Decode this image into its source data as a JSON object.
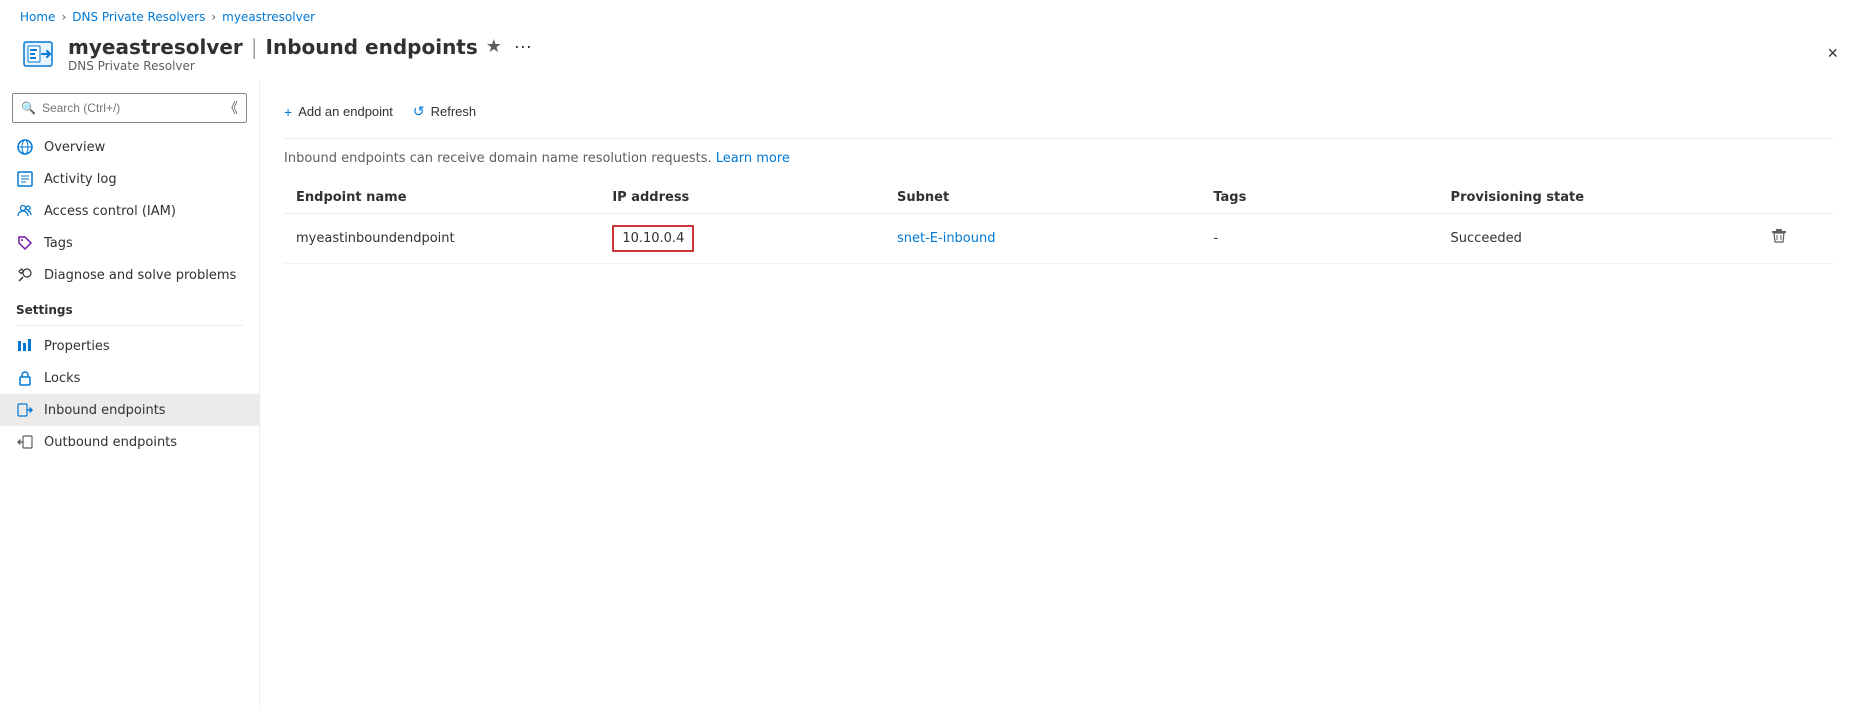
{
  "breadcrumb": {
    "home": "Home",
    "dns_private_resolvers": "DNS Private Resolvers",
    "resolver": "myeastresolver",
    "separator": ">"
  },
  "header": {
    "resource_name": "myeastresolver",
    "separator": "|",
    "page_title": "Inbound endpoints",
    "subtitle": "DNS Private Resolver",
    "star_symbol": "★",
    "ellipsis_symbol": "···",
    "close_symbol": "×"
  },
  "sidebar": {
    "search_placeholder": "Search (Ctrl+/)",
    "collapse_symbol": "《",
    "nav_items": [
      {
        "id": "overview",
        "label": "Overview",
        "icon": "globe"
      },
      {
        "id": "activity-log",
        "label": "Activity log",
        "icon": "activity"
      },
      {
        "id": "access-control",
        "label": "Access control (IAM)",
        "icon": "people"
      },
      {
        "id": "tags",
        "label": "Tags",
        "icon": "tag"
      },
      {
        "id": "diagnose",
        "label": "Diagnose and solve problems",
        "icon": "wrench"
      }
    ],
    "settings_label": "Settings",
    "settings_items": [
      {
        "id": "properties",
        "label": "Properties",
        "icon": "properties"
      },
      {
        "id": "locks",
        "label": "Locks",
        "icon": "lock"
      },
      {
        "id": "inbound-endpoints",
        "label": "Inbound endpoints",
        "icon": "inbound",
        "active": true
      },
      {
        "id": "outbound-endpoints",
        "label": "Outbound endpoints",
        "icon": "outbound"
      }
    ]
  },
  "toolbar": {
    "add_label": "Add an endpoint",
    "add_icon": "+",
    "refresh_label": "Refresh",
    "refresh_icon": "↺"
  },
  "info_bar": {
    "text": "Inbound endpoints can receive domain name resolution requests.",
    "learn_more": "Learn more"
  },
  "table": {
    "columns": {
      "endpoint_name": "Endpoint name",
      "ip_address": "IP address",
      "subnet": "Subnet",
      "tags": "Tags",
      "provisioning_state": "Provisioning state"
    },
    "rows": [
      {
        "endpoint_name": "myeastinboundendpoint",
        "ip_address": "10.10.0.4",
        "subnet": "snet-E-inbound",
        "tags": "-",
        "provisioning_state": "Succeeded"
      }
    ]
  }
}
